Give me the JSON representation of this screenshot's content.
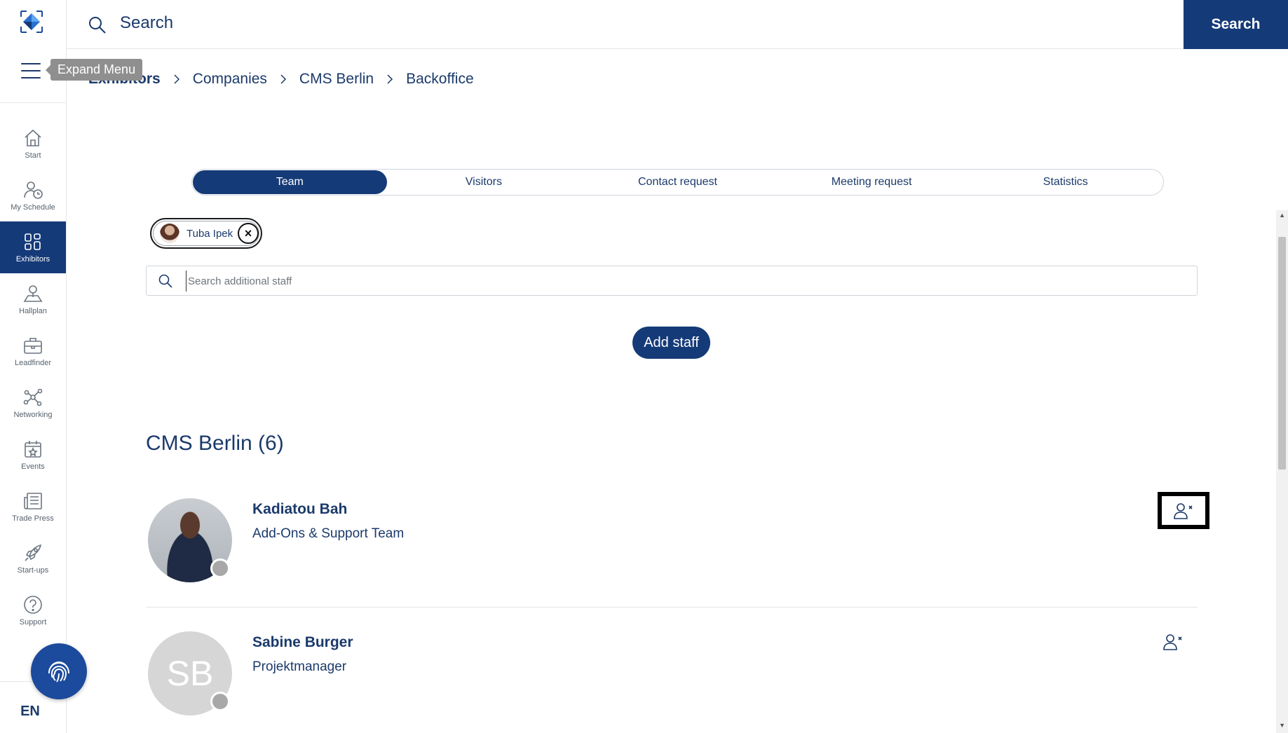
{
  "sidebar": {
    "tooltip": "Expand Menu",
    "nav": [
      {
        "label": "Start",
        "icon": "home-icon"
      },
      {
        "label": "My Schedule",
        "icon": "schedule-icon"
      },
      {
        "label": "Exhibitors",
        "icon": "grid-icon",
        "active": true
      },
      {
        "label": "Hallplan",
        "icon": "map-pin-icon"
      },
      {
        "label": "Leadfinder",
        "icon": "briefcase-icon"
      },
      {
        "label": "Networking",
        "icon": "network-icon"
      },
      {
        "label": "Events",
        "icon": "calendar-star-icon"
      },
      {
        "label": "Trade Press",
        "icon": "newspaper-icon"
      },
      {
        "label": "Start-ups",
        "icon": "rocket-icon"
      },
      {
        "label": "Support",
        "icon": "question-icon"
      }
    ],
    "language": "EN"
  },
  "topbar": {
    "search_placeholder": "Search",
    "search_button": "Search"
  },
  "breadcrumb": [
    "Exhibitors",
    "Companies",
    "CMS Berlin",
    "Backoffice"
  ],
  "tabs": [
    {
      "label": "Team",
      "active": true
    },
    {
      "label": "Visitors"
    },
    {
      "label": "Contact request"
    },
    {
      "label": "Meeting request"
    },
    {
      "label": "Statistics"
    }
  ],
  "selected_staff": {
    "name": "Tuba Ipek"
  },
  "staff_search": {
    "placeholder": "Search additional staff"
  },
  "add_staff_button": "Add staff",
  "section": {
    "title": "CMS Berlin (6)"
  },
  "members": [
    {
      "name": "Kadiatou Bah",
      "role": "Add-Ons & Support Team",
      "avatar": "photo"
    },
    {
      "name": "Sabine Burger",
      "role": "Projektmanager",
      "avatar": "initials",
      "initials": "SB"
    }
  ],
  "colors": {
    "primary": "#153a78",
    "text": "#1b3a6b",
    "border": "#cfd5dc"
  }
}
